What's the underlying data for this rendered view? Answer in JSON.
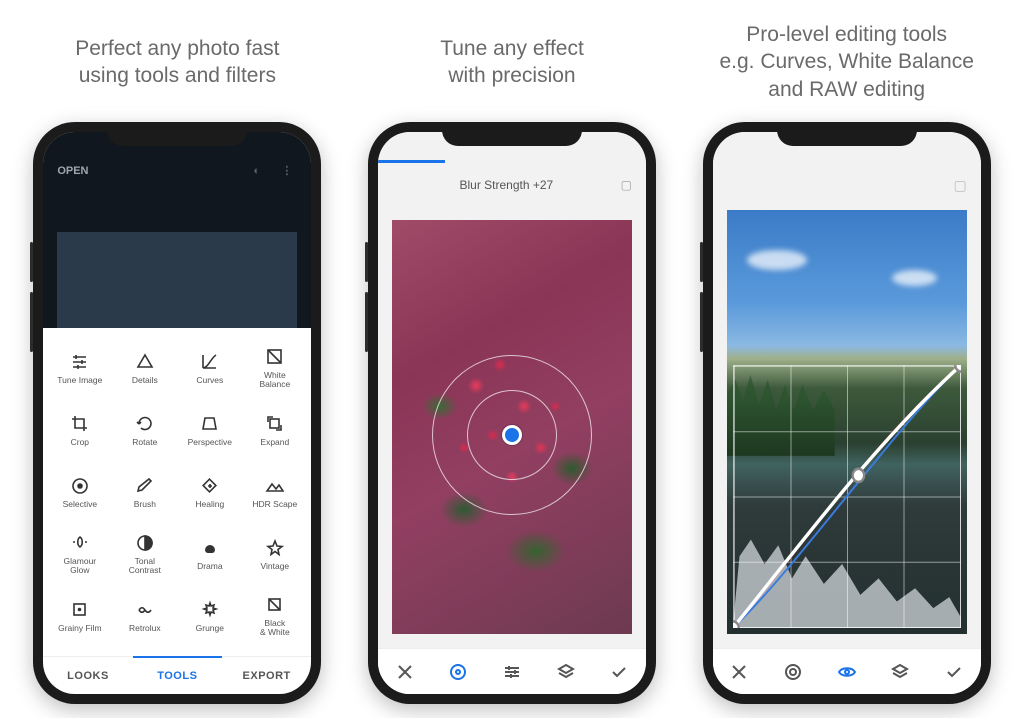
{
  "captions": [
    "Perfect any photo fast\nusing tools and filters",
    "Tune any effect\nwith precision",
    "Pro-level editing tools\ne.g. Curves, White Balance\nand RAW editing"
  ],
  "phone1": {
    "topbar": {
      "open": "OPEN"
    },
    "tools": [
      {
        "label": "Tune Image"
      },
      {
        "label": "Details"
      },
      {
        "label": "Curves"
      },
      {
        "label": "White\nBalance"
      },
      {
        "label": "Crop"
      },
      {
        "label": "Rotate"
      },
      {
        "label": "Perspective"
      },
      {
        "label": "Expand"
      },
      {
        "label": "Selective"
      },
      {
        "label": "Brush"
      },
      {
        "label": "Healing"
      },
      {
        "label": "HDR Scape"
      },
      {
        "label": "Glamour\nGlow"
      },
      {
        "label": "Tonal\nContrast"
      },
      {
        "label": "Drama"
      },
      {
        "label": "Vintage"
      },
      {
        "label": "Grainy Film"
      },
      {
        "label": "Retrolux"
      },
      {
        "label": "Grunge"
      },
      {
        "label": "Black\n& White"
      }
    ],
    "tabs": {
      "looks": "LOOKS",
      "tools": "TOOLS",
      "export": "EXPORT"
    }
  },
  "phone2": {
    "status": "Blur Strength +27"
  }
}
